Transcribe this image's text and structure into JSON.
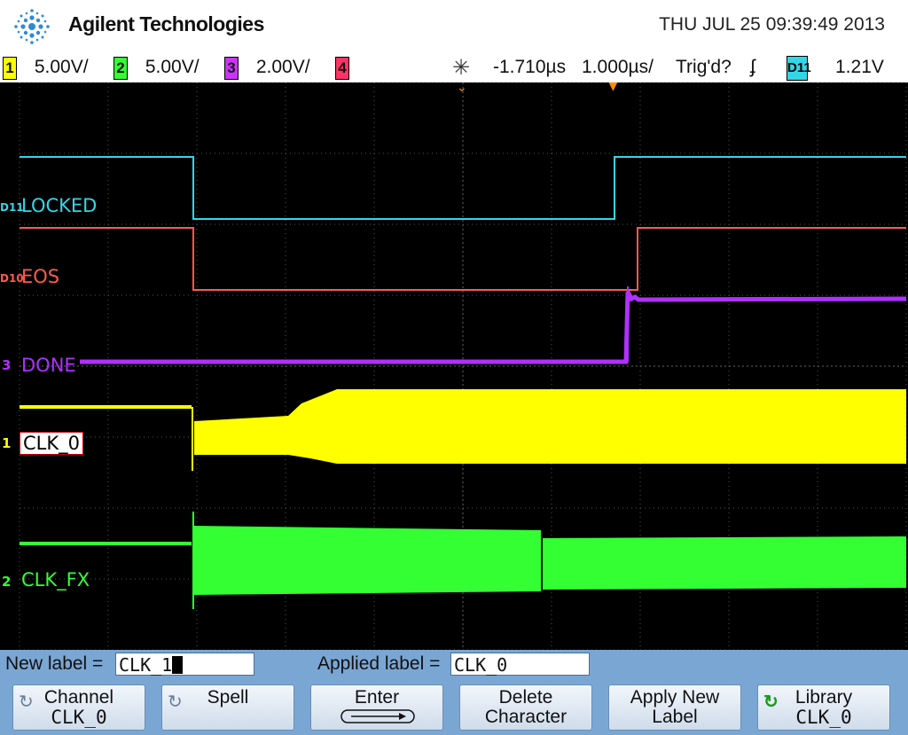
{
  "header": {
    "brand": "Agilent Technologies",
    "datetime": "THU JUL 25 09:39:49 2013",
    "brand_color": "#2d8bd2"
  },
  "status_bar": {
    "channels": [
      {
        "num": "1",
        "scale": "5.00V/",
        "color": "#ffff00"
      },
      {
        "num": "2",
        "scale": "5.00V/",
        "color": "#33ff33"
      },
      {
        "num": "3",
        "scale": "2.00V/",
        "color": "#cc33ff"
      },
      {
        "num": "4",
        "scale": "",
        "color": "#ff3366"
      }
    ],
    "time_delay": "-1.710µs",
    "time_scale": "1.000µs/",
    "trigger_status": "Trig'd?",
    "trigger_source": "D11",
    "trigger_level": "1.21V",
    "trigger_icon": "rising-edge-icon",
    "run_icon": "acquire-icon"
  },
  "traces": {
    "locked": {
      "label": "LOCKED",
      "marker": "D11",
      "color": "#33d6e8"
    },
    "eos": {
      "label": "EOS",
      "marker": "D10",
      "color": "#ff5b4b"
    },
    "done": {
      "label": "DONE",
      "marker": "3",
      "color": "#b030ff"
    },
    "clk0": {
      "label": "CLK_0",
      "marker": "1",
      "color": "#ffff00"
    },
    "clkfx": {
      "label": "CLK_FX",
      "marker": "2",
      "color": "#33ff33"
    }
  },
  "label_editor": {
    "new_label_caption": "New label =",
    "new_label_value": "CLK_1",
    "applied_label_caption": "Applied label =",
    "applied_label_value": "CLK_0"
  },
  "softkeys": [
    {
      "line1": "Channel",
      "line2": "CLK_0",
      "icon": "rotate-knob-icon"
    },
    {
      "line1": "Spell",
      "line2": "",
      "icon": "rotate-knob-icon"
    },
    {
      "line1": "Enter",
      "line2": "",
      "icon": "enter-arrow-icon"
    },
    {
      "line1": "Delete",
      "line2": "Character",
      "icon": ""
    },
    {
      "line1": "Apply New",
      "line2": "Label",
      "icon": ""
    },
    {
      "line1": "Library",
      "line2": "CLK_0",
      "icon": "refresh-green-icon"
    }
  ]
}
